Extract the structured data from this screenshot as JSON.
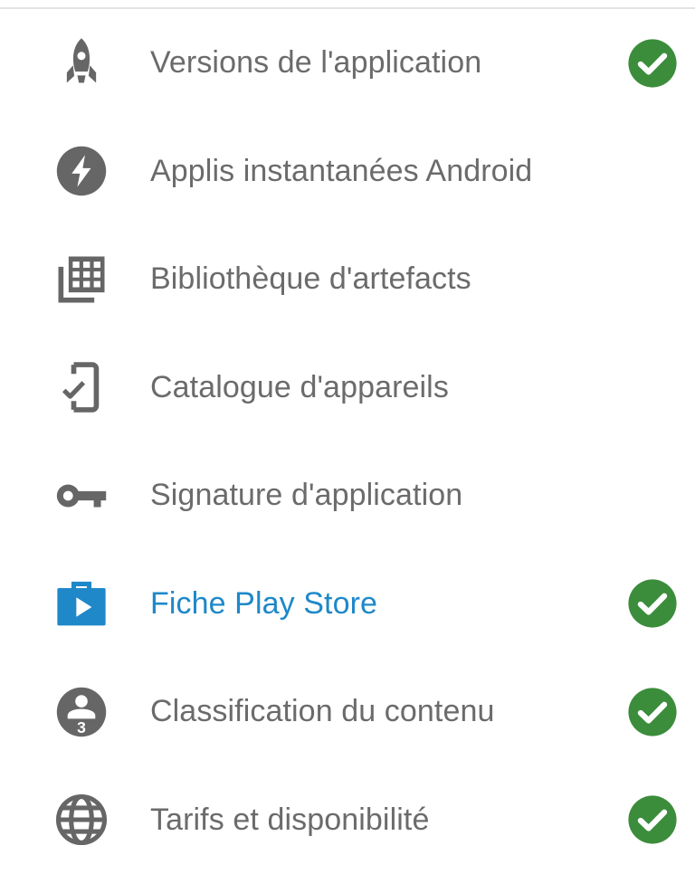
{
  "sidebar": {
    "items": [
      {
        "label": "Versions de l'application",
        "icon": "rocket-icon",
        "complete": true,
        "active": false
      },
      {
        "label": "Applis instantanées Android",
        "icon": "instant-app-bolt-icon",
        "complete": false,
        "active": false
      },
      {
        "label": "Bibliothèque d'artefacts",
        "icon": "artifact-library-icon",
        "complete": false,
        "active": false
      },
      {
        "label": "Catalogue d'appareils",
        "icon": "device-catalog-icon",
        "complete": false,
        "active": false
      },
      {
        "label": "Signature d'application",
        "icon": "key-icon",
        "complete": false,
        "active": false
      },
      {
        "label": "Fiche Play Store",
        "icon": "play-store-listing-icon",
        "complete": true,
        "active": true
      },
      {
        "label": "Classification du contenu",
        "icon": "content-rating-icon",
        "complete": true,
        "active": false
      },
      {
        "label": "Tarifs et disponibilité",
        "icon": "globe-icon",
        "complete": true,
        "active": false
      }
    ]
  },
  "colors": {
    "icon_default": "#666666",
    "text_default": "#6b6b6b",
    "active": "#1e88c9",
    "check": "#3b8d3b"
  }
}
